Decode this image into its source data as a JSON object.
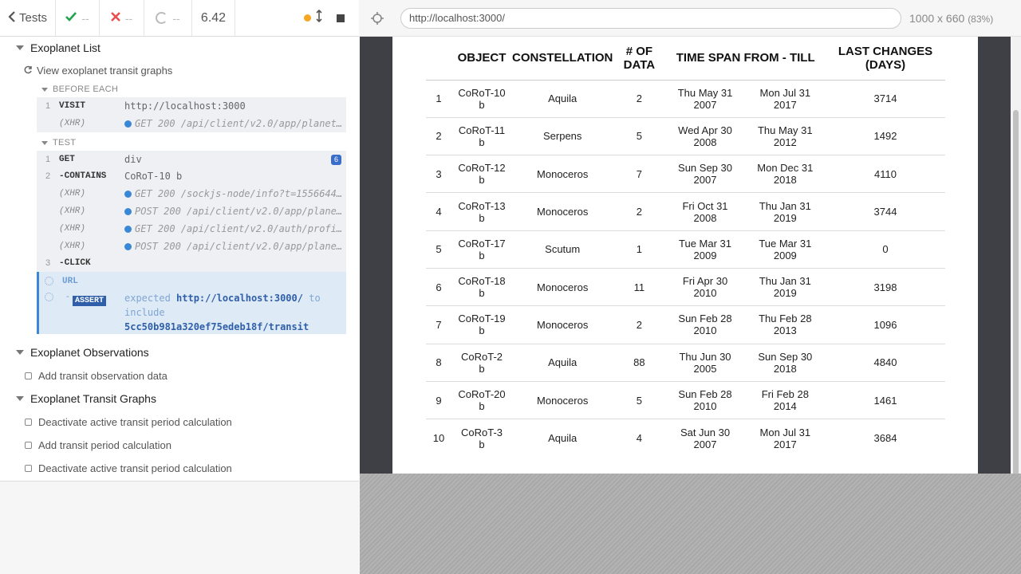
{
  "reporter": {
    "header": {
      "tests_label": "Tests",
      "passed": "--",
      "failed": "--",
      "pending": "--",
      "duration": "6.42"
    },
    "suites": [
      {
        "title": "Exoplanet List",
        "test": "View exoplanet transit graphs",
        "before_each_label": "BEFORE EACH",
        "test_label": "TEST",
        "before_each_cmds": [
          {
            "num": "1",
            "name": "VISIT",
            "msg": "http://localhost:3000"
          },
          {
            "num": "",
            "name": "(XHR)",
            "msg": "GET 200 /api/client/v2.0/app/planet…"
          }
        ],
        "test_cmds": [
          {
            "num": "1",
            "name": "GET",
            "msg": "div",
            "badge": "6"
          },
          {
            "num": "2",
            "name": "-CONTAINS",
            "msg": "CoRoT-10 b"
          },
          {
            "num": "",
            "name": "(XHR)",
            "msg": "GET 200 /sockjs-node/info?t=1556644…"
          },
          {
            "num": "",
            "name": "(XHR)",
            "msg": "POST 200 /api/client/v2.0/app/plane…"
          },
          {
            "num": "",
            "name": "(XHR)",
            "msg": "GET 200 /api/client/v2.0/auth/profi…"
          },
          {
            "num": "",
            "name": "(XHR)",
            "msg": "POST 200 /api/client/v2.0/app/plane…"
          },
          {
            "num": "3",
            "name": "-CLICK",
            "msg": ""
          }
        ],
        "pending": {
          "url_label": "URL",
          "assert_label": "ASSERT",
          "expected_word": "expected",
          "expected_url": "http://localhost:3000/",
          "to_word": "to",
          "include_word": "include",
          "include_value": "5cc50b981a320ef75edeb18f/transit"
        }
      },
      {
        "title": "Exoplanet Observations",
        "tests": [
          "Add transit observation data"
        ]
      },
      {
        "title": "Exoplanet Transit Graphs",
        "tests": [
          "Deactivate active transit period calculation",
          "Add transit period calculation",
          "Deactivate active transit period calculation"
        ]
      }
    ]
  },
  "aut": {
    "url": "http://localhost:3000/",
    "viewport": "1000 x 660",
    "scale": "(83%)"
  },
  "table": {
    "headers": [
      "",
      "OBJECT",
      "CONSTELLATION",
      "# OF\nDATA",
      "TIME SPAN FROM - TILL",
      "",
      "LAST CHANGES\n(DAYS)"
    ],
    "rows": [
      [
        "1",
        "CoRoT-10\nb",
        "Aquila",
        "2",
        "Thu May 31\n2007",
        "Mon Jul 31\n2017",
        "3714"
      ],
      [
        "2",
        "CoRoT-11\nb",
        "Serpens",
        "5",
        "Wed Apr 30\n2008",
        "Thu May 31\n2012",
        "1492"
      ],
      [
        "3",
        "CoRoT-12\nb",
        "Monoceros",
        "7",
        "Sun Sep 30\n2007",
        "Mon Dec 31\n2018",
        "4110"
      ],
      [
        "4",
        "CoRoT-13\nb",
        "Monoceros",
        "2",
        "Fri Oct 31\n2008",
        "Thu Jan 31\n2019",
        "3744"
      ],
      [
        "5",
        "CoRoT-17\nb",
        "Scutum",
        "1",
        "Tue Mar 31\n2009",
        "Tue Mar 31\n2009",
        "0"
      ],
      [
        "6",
        "CoRoT-18\nb",
        "Monoceros",
        "11",
        "Fri Apr 30\n2010",
        "Thu Jan 31\n2019",
        "3198"
      ],
      [
        "7",
        "CoRoT-19\nb",
        "Monoceros",
        "2",
        "Sun Feb 28\n2010",
        "Thu Feb 28\n2013",
        "1096"
      ],
      [
        "8",
        "CoRoT-2\nb",
        "Aquila",
        "88",
        "Thu Jun 30\n2005",
        "Sun Sep 30\n2018",
        "4840"
      ],
      [
        "9",
        "CoRoT-20\nb",
        "Monoceros",
        "5",
        "Sun Feb 28\n2010",
        "Fri Feb 28\n2014",
        "1461"
      ],
      [
        "10",
        "CoRoT-3\nb",
        "Aquila",
        "4",
        "Sat Jun 30\n2007",
        "Mon Jul 31\n2017",
        "3684"
      ]
    ]
  }
}
